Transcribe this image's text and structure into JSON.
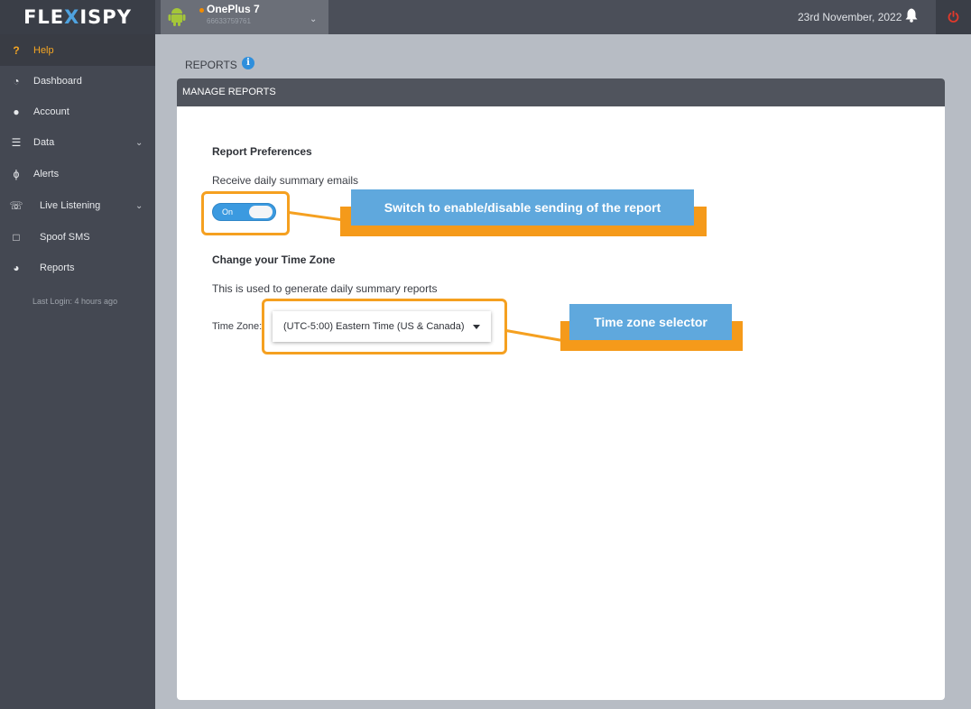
{
  "app": {
    "logo": "FLEXISPY"
  },
  "device": {
    "name": "OnePlus 7",
    "number": "66633759761"
  },
  "header": {
    "date": "23rd November, 2022"
  },
  "sidebar": {
    "items": [
      {
        "label": "Help",
        "icon": "question-icon"
      },
      {
        "label": "Dashboard",
        "icon": "dashboard-icon"
      },
      {
        "label": "Account",
        "icon": "user-icon"
      },
      {
        "label": "Data",
        "icon": "database-icon"
      },
      {
        "label": "Alerts",
        "icon": "bolt-icon"
      },
      {
        "label": "Live Listening",
        "icon": "phone-icon"
      },
      {
        "label": "Spoof SMS",
        "icon": "sms-icon"
      },
      {
        "label": "Reports",
        "icon": "pie-chart-icon"
      }
    ],
    "last_login": "Last Login: 4 hours ago"
  },
  "page": {
    "title": "REPORTS",
    "panel_title": "MANAGE REPORTS",
    "report_prefs_heading": "Report Preferences",
    "receive_label": "Receive daily summary emails",
    "toggle_label": "On",
    "timezone_heading": "Change your Time Zone",
    "timezone_desc": "This is used to generate daily summary reports",
    "timezone_label": "Time Zone:",
    "timezone_value": "(UTC-5:00) Eastern Time (US & Canada)"
  },
  "annotations": {
    "switch_callout": "Switch to enable/disable sending of the report",
    "timezone_callout": "Time zone selector"
  },
  "colors": {
    "accent": "#3b9ae0",
    "highlight": "#f5a020",
    "callout": "#5fa8dd",
    "help": "#f5a623"
  }
}
